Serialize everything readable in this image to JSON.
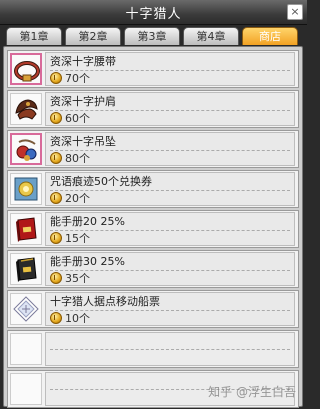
{
  "window": {
    "title": "十字猎人",
    "close_glyph": "×"
  },
  "tabs": [
    {
      "label": "第1章",
      "active": false
    },
    {
      "label": "第2章",
      "active": false
    },
    {
      "label": "第3章",
      "active": false
    },
    {
      "label": "第4章",
      "active": false
    },
    {
      "label": "商店",
      "active": true
    }
  ],
  "items": [
    {
      "name": "资深十字腰带",
      "price": "70个",
      "icon": "belt-icon",
      "selected": true
    },
    {
      "name": "资深十字护肩",
      "price": "60个",
      "icon": "shoulder-armor-icon",
      "selected": false
    },
    {
      "name": "资深十字吊坠",
      "price": "80个",
      "icon": "pendant-icon",
      "selected": true
    },
    {
      "name": "咒语痕迹50个兑换券",
      "price": "20个",
      "icon": "voucher-icon",
      "selected": false
    },
    {
      "name": "能手册20 25%",
      "price": "15个",
      "icon": "skill-book-red-icon",
      "selected": false
    },
    {
      "name": "能手册30 25%",
      "price": "35个",
      "icon": "skill-book-dark-icon",
      "selected": false
    },
    {
      "name": "十字猎人据点移动船票",
      "price": "10个",
      "icon": "ticket-icon",
      "selected": false
    }
  ],
  "empty_slots": 2,
  "watermark": "知乎 @浮生白吾",
  "colors": {
    "active_tab": "#f2a124",
    "selected_border": "#d86a9a",
    "coin": "#e2a51a"
  }
}
